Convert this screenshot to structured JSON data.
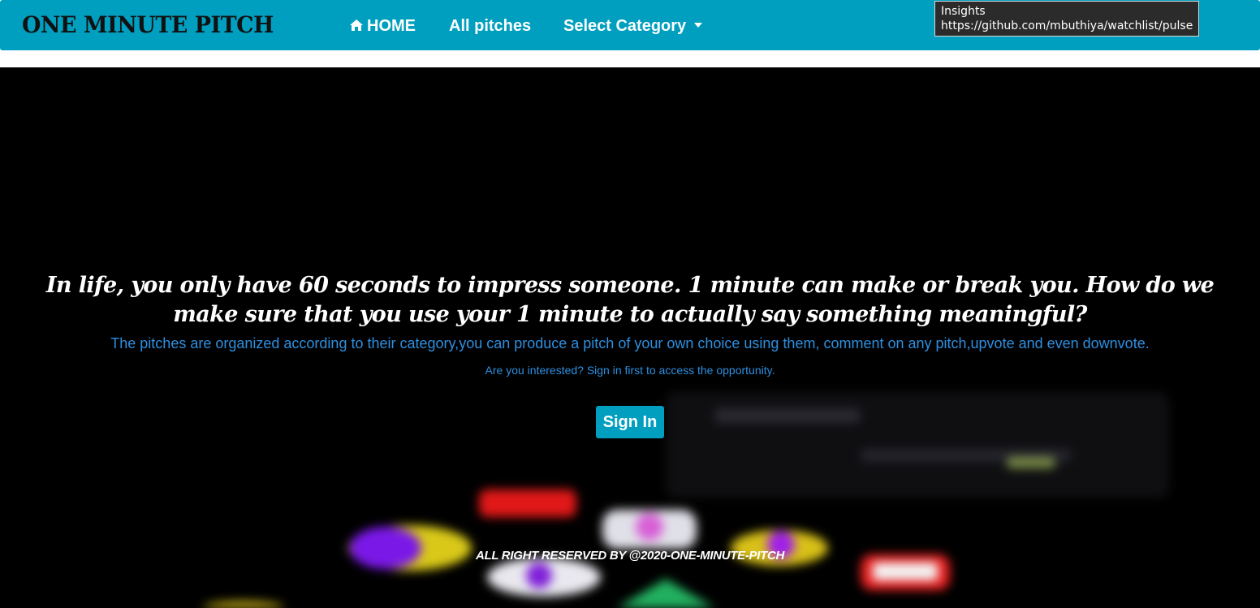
{
  "navbar": {
    "brand": "ONE MINUTE PITCH",
    "home_label": "HOME",
    "all_pitches_label": "All pitches",
    "category_label": "Select Category",
    "icons": {
      "home": "home-icon",
      "dropdown": "chevron-down-icon"
    },
    "colors": {
      "background": "#009fbf",
      "text": "#ffffff",
      "brand_text": "#111111"
    }
  },
  "tooltip": {
    "title": "Insights",
    "url": "https://github.com/mbuthiya/watchlist/pulse"
  },
  "hero": {
    "headline": "In life, you only have 60 seconds to impress someone. 1 minute can make or break you. How do we make sure that you use your 1 minute to actually say something meaningful?",
    "description": "The pitches are organized according to their category,you can produce a pitch of your own choice using them, comment on any pitch,upvote and even downvote.",
    "interest_prompt": "Are you interested? Sign in first to access the opportunity.",
    "signin_label": "Sign In",
    "footer": "ALL RIGHT RESERVED BY @2020-ONE-MINUTE-PITCH",
    "colors": {
      "background": "#000000",
      "headline": "#ffffff",
      "body_text": "#2e8fe0",
      "button": "#009fbf"
    }
  }
}
